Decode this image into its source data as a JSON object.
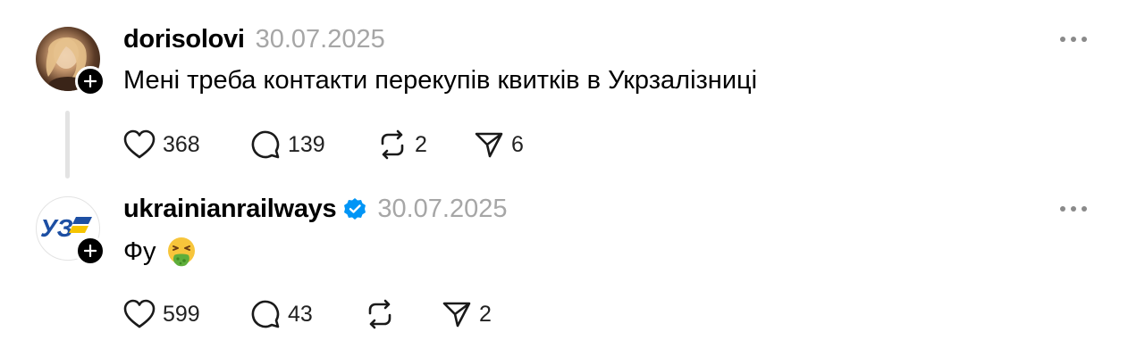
{
  "posts": [
    {
      "username": "dorisolovi",
      "verified": false,
      "timestamp": "30.07.2025",
      "text": "Мені треба контакти перекупів квитків в Укрзалізниці",
      "emoji": "",
      "likes": "368",
      "replies": "139",
      "reposts": "2",
      "shares": "6"
    },
    {
      "username": "ukrainianrailways",
      "verified": true,
      "timestamp": "30.07.2025",
      "text": "Фу",
      "emoji": "🤮",
      "likes": "599",
      "replies": "43",
      "reposts": "",
      "shares": "2"
    }
  ],
  "icons": {
    "like": "heart-icon",
    "reply": "comment-icon",
    "repost": "repost-icon",
    "share": "send-icon",
    "more": "more-horizontal-icon",
    "follow": "plus-icon",
    "verified": "verified-badge-icon"
  },
  "colors": {
    "verified_blue": "#0095f6",
    "muted_gray": "#a6a6a6",
    "logo_blue": "#1d4fa3",
    "logo_yellow": "#f5c400"
  }
}
